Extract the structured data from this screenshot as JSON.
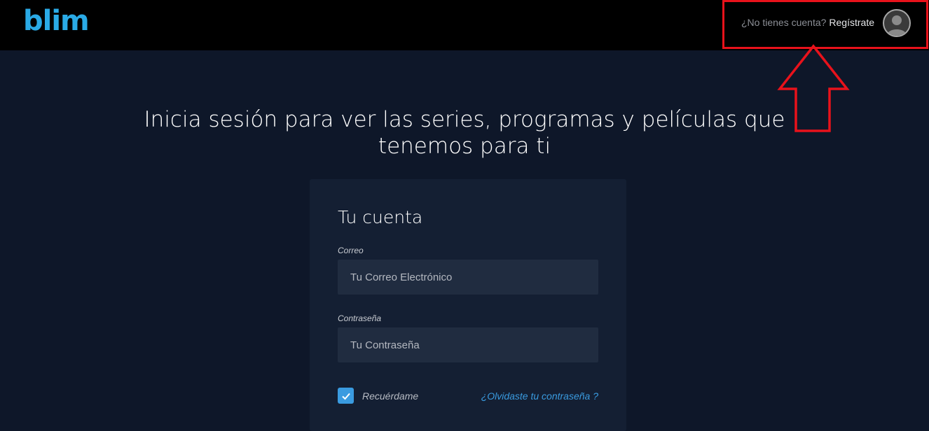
{
  "header": {
    "logo_text": "blim",
    "no_account_text": "¿No tienes cuenta?",
    "register_label": "Regístrate",
    "avatar_icon": "user-avatar-icon"
  },
  "annotation": {
    "color": "#e8121b"
  },
  "main": {
    "headline": "Inicia sesión para ver las series, programas y películas que tenemos para ti"
  },
  "login_card": {
    "title": "Tu cuenta",
    "email_label": "Correo",
    "email_placeholder": "Tu Correo Electrónico",
    "password_label": "Contraseña",
    "password_placeholder": "Tu Contraseña",
    "remember_label": "Recuérdame",
    "remember_checked": true,
    "forgot_label": "¿Olvidaste tu contraseña ?"
  },
  "colors": {
    "brand": "#2aaae6",
    "background": "#0e1729",
    "card": "#141f33",
    "input": "#202c40",
    "accent": "#3a9be0"
  }
}
